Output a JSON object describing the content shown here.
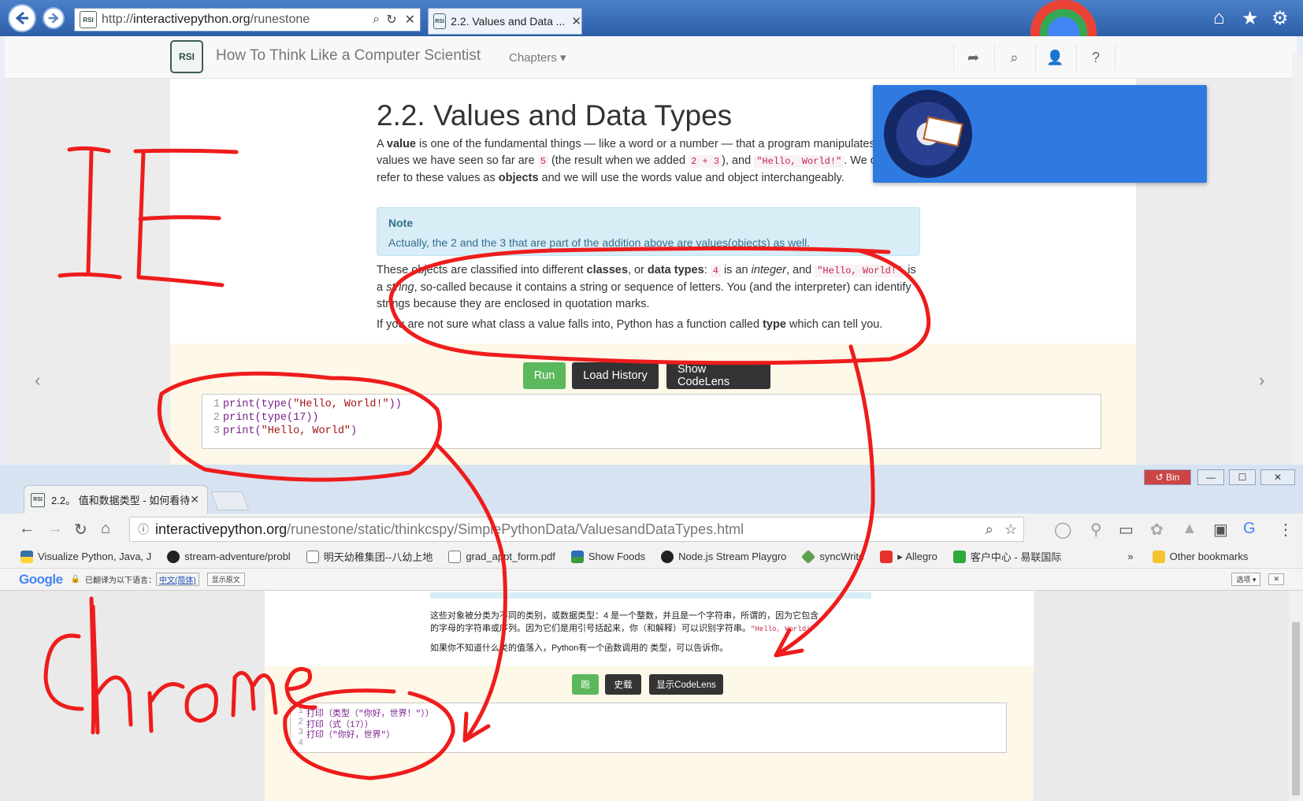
{
  "ie": {
    "address_prefix": "http://",
    "address_host": "interactivepython.org",
    "address_rest": "/runestone",
    "tab_title": "2.2. Values and Data ...",
    "site_title": "How To Think Like a Computer Scientist",
    "chapters_label": "Chapters ▾",
    "logo_text": "RSI",
    "page_heading": "2.2. Values and Data Types",
    "para1": {
      "t1": "A ",
      "b1": "value",
      "t2": " is one of the fundamental things — like a word or a number — that a program manipulates. The",
      "t3": "values we have seen so far are ",
      "c1": "5",
      "t4": " (the result when we added ",
      "c2": "2 + 3",
      "t5": "), and ",
      "c3": "\"Hello, World!\"",
      "t6": ". We often",
      "t7": "refer to these values as ",
      "b2": "objects",
      "t8": " and we will use the words value and object interchangeably."
    },
    "note_title": "Note",
    "note_body": "Actually, the 2 and the 3 that are part of the addition above are values(objects) as well.",
    "para2": {
      "t1": "These objects are classified into different ",
      "b1": "classes",
      "t2": ", or ",
      "b2": "data types",
      "t3": ": ",
      "c1": "4",
      "t4": " is an ",
      "i1": "integer",
      "t5": ", and ",
      "c2": "\"Hello, World!\"",
      "t6": " is",
      "t7": "a ",
      "i2": "string",
      "t8": ", so-called because it contains a string or sequence of letters. You (and the interpreter) can identify",
      "t9": "strings because they are enclosed in quotation marks."
    },
    "para3": {
      "t1": "If you are not sure what class a value falls into, Python has a function called ",
      "b1": "type",
      "t2": " which can tell you."
    },
    "buttons": {
      "run": "Run",
      "load_history": "Load History",
      "show_codelens": "Show CodeLens"
    },
    "code_lines": [
      {
        "num": "1",
        "a": "print(type(",
        "s": "\"Hello, World!\"",
        "b": "))"
      },
      {
        "num": "2",
        "a": "print(type(17))",
        "s": "",
        "b": ""
      },
      {
        "num": "3",
        "a": "print(",
        "s": "\"Hello, World\"",
        "b": ")"
      }
    ],
    "pager_prev": "‹",
    "pager_next": "›",
    "colors": {
      "run": "#5cb85c",
      "dark_button": "#333333",
      "popup": "#2f7ae0"
    }
  },
  "chrome": {
    "tab_title": "2.2。 值和数据类型 - 如何看待",
    "window_badge": "Bin",
    "omnibox_host": "interactivepython.org",
    "omnibox_path": "/runestone/static/thinkcspy/SimplePythonData/ValuesandDataTypes.html",
    "bookmarks": [
      "Visualize Python, Java, J",
      "stream-adventure/probl",
      "明天幼稚集团--八幼上地",
      "grad_appt_form.pdf",
      "Show Foods",
      "Node.js Stream Playgro",
      "syncWrite",
      "Allegro",
      "客户中心 - 易联国际"
    ],
    "bookmarks_more": "»",
    "other_bookmarks": "Other bookmarks",
    "translate": {
      "logo": "Google",
      "text": "已翻译为以下语言：",
      "language": "中文(简体)",
      "show_original": "显示原文",
      "options": "选项 ▾"
    },
    "zh_para": {
      "line1": "这些对象被分类为不同的类别，或数据类型：4 是一个整数，并且是一个字符串，所谓的，因为它包含",
      "line2a": "的字母的字符串或序列。因为它们是用引号括起来，你（和解释）可以识别字符串。",
      "line2code": "\"Hello, World!\"",
      "line3": "如果你不知道什么类的值落入，Python有一个函数调用的 类型，可以告诉你。"
    },
    "buttons": {
      "run": "跑",
      "load_history": "史载",
      "show_codelens": "显示CodeLens"
    },
    "code_lines": [
      {
        "num": "1",
        "text": "打印（类型（\"你好，世界！\"））"
      },
      {
        "num": "2",
        "text": "打印（式（17））"
      },
      {
        "num": "3",
        "text": "打印（\"你好，世界\"）"
      },
      {
        "num": "4",
        "text": ""
      }
    ]
  },
  "annotations": {
    "ie_label": "IE",
    "chrome_label": "Chrome",
    "ink_color": "#ee1c1c"
  }
}
